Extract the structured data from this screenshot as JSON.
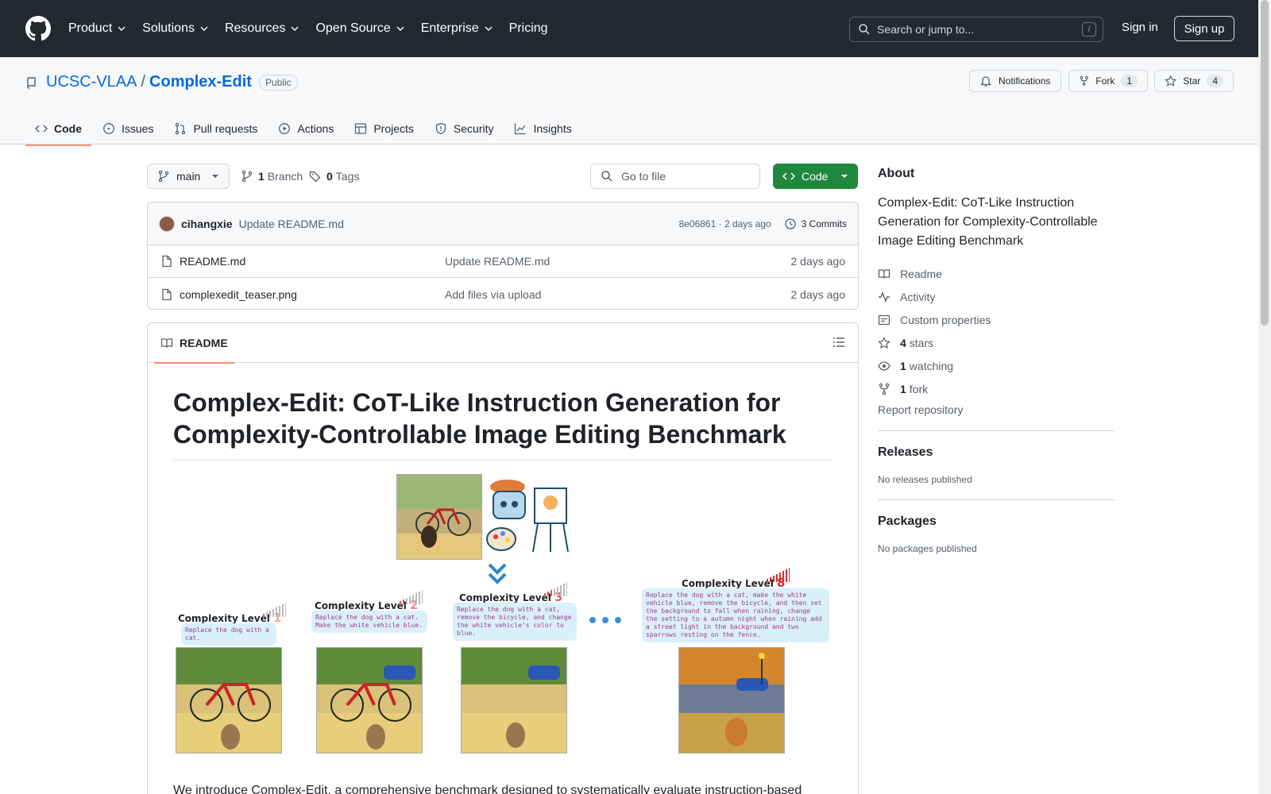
{
  "header": {
    "nav": [
      "Product",
      "Solutions",
      "Resources",
      "Open Source",
      "Enterprise",
      "Pricing"
    ],
    "search_placeholder": "Search or jump to...",
    "search_key": "/",
    "sign_in": "Sign in",
    "sign_up": "Sign up"
  },
  "repo": {
    "owner": "UCSC-VLAA",
    "sep": "/",
    "name": "Complex-Edit",
    "visibility": "Public",
    "notifications": "Notifications",
    "fork_label": "Fork",
    "fork_count": "1",
    "star_label": "Star",
    "star_count": "4"
  },
  "tabs": [
    "Code",
    "Issues",
    "Pull requests",
    "Actions",
    "Projects",
    "Security",
    "Insights"
  ],
  "toolbar": {
    "branch": "main",
    "branch_count": "1",
    "branch_label": "Branch",
    "tag_count": "0",
    "tag_label": "Tags",
    "goto_placeholder": "Go to file",
    "code_label": "Code"
  },
  "commit": {
    "author": "cihangxie",
    "message": "Update README.md",
    "hash_time": "8e06861 · 2 days ago",
    "commits": "3 Commits"
  },
  "files": [
    {
      "name": "README.md",
      "message": "Update README.md",
      "date": "2 days ago"
    },
    {
      "name": "complexedit_teaser.png",
      "message": "Add files via upload",
      "date": "2 days ago"
    }
  ],
  "readme": {
    "tab": "README",
    "title": "Complex-Edit: CoT-Like Instruction Generation for Complexity-Controllable Image Editing Benchmark",
    "intro": "We introduce Complex-Edit, a comprehensive benchmark designed to systematically evaluate instruction-based",
    "teaser": {
      "levels": [
        {
          "prefix": "Complexity Level",
          "num": "1",
          "instruction": "Replace the dog with a cat."
        },
        {
          "prefix": "Complexity Level",
          "num": "2",
          "instruction": "Replace the dog with a cat. Make the white vehicle blue."
        },
        {
          "prefix": "Complexity Level",
          "num": "3",
          "instruction": "Replace the dog with a cat, remove the bicycle, and change the white vehicle's color to blue."
        },
        {
          "prefix": "Complexity Level",
          "num": "8",
          "instruction": "Replace the dog with a cat, make the white vehicle blue, remove the bicycle, and then set the background to fall when raining, change the setting to a autumn night when raining add a street light in the background and two sparrows resting on the fence."
        }
      ]
    }
  },
  "about": {
    "heading": "About",
    "description": "Complex-Edit: CoT-Like Instruction Generation for Complexity-Controllable Image Editing Benchmark",
    "readme": "Readme",
    "activity": "Activity",
    "custom": "Custom properties",
    "stars_n": "4",
    "stars": "stars",
    "watch_n": "1",
    "watching": "watching",
    "fork_n": "1",
    "fork": "fork",
    "report": "Report repository"
  },
  "releases": {
    "heading": "Releases",
    "text": "No releases published"
  },
  "packages": {
    "heading": "Packages",
    "text": "No packages published"
  },
  "colors": {
    "accent": "#0969da",
    "primary_button": "#1f883d",
    "tab_underline": "#fd8c73",
    "header_bg": "#24292f"
  }
}
